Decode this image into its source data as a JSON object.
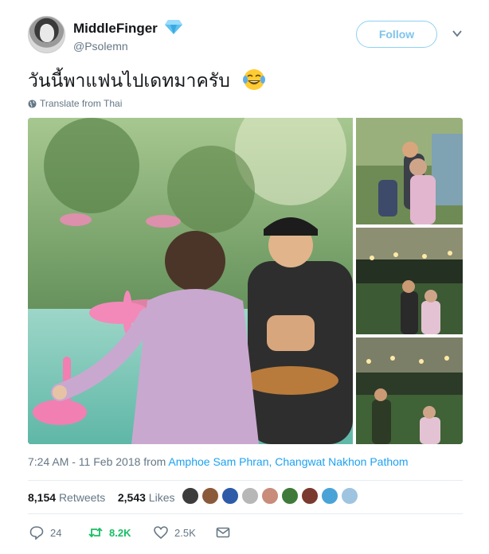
{
  "user": {
    "name": "MiddleFinger",
    "handle": "@Psolemn",
    "avatar_icon": "profile-photo",
    "badge_icon": "diamond-emoji"
  },
  "follow_label": "Follow",
  "tweet": {
    "text": "วันนี้พาแฟนไปเดทมาครับ",
    "emoji_icon": "face-with-tears-of-joy-emoji"
  },
  "translate": {
    "label": "Translate from Thai",
    "icon": "globe-icon"
  },
  "media": {
    "main_photo": "elderly woman and young man in park by pond with pink flamingo floats",
    "side_photos": [
      "couple posing outdoors",
      "couple walking at night",
      "couple in park at night"
    ]
  },
  "meta": {
    "time": "7:24 AM - 11 Feb 2018 from ",
    "location": "Amphoe Sam Phran, Changwat Nakhon Pathom"
  },
  "stats": {
    "retweets_count": "8,154",
    "retweets_label": "Retweets",
    "likes_count": "2,543",
    "likes_label": "Likes"
  },
  "actions": {
    "reply_count": "24",
    "retweet_count": "8.2K",
    "like_count": "2.5K"
  },
  "colors": {
    "accent": "#1da1f2",
    "retweet_green": "#17bf63",
    "follow_border": "#8fd0f3",
    "muted_text": "#657786"
  }
}
